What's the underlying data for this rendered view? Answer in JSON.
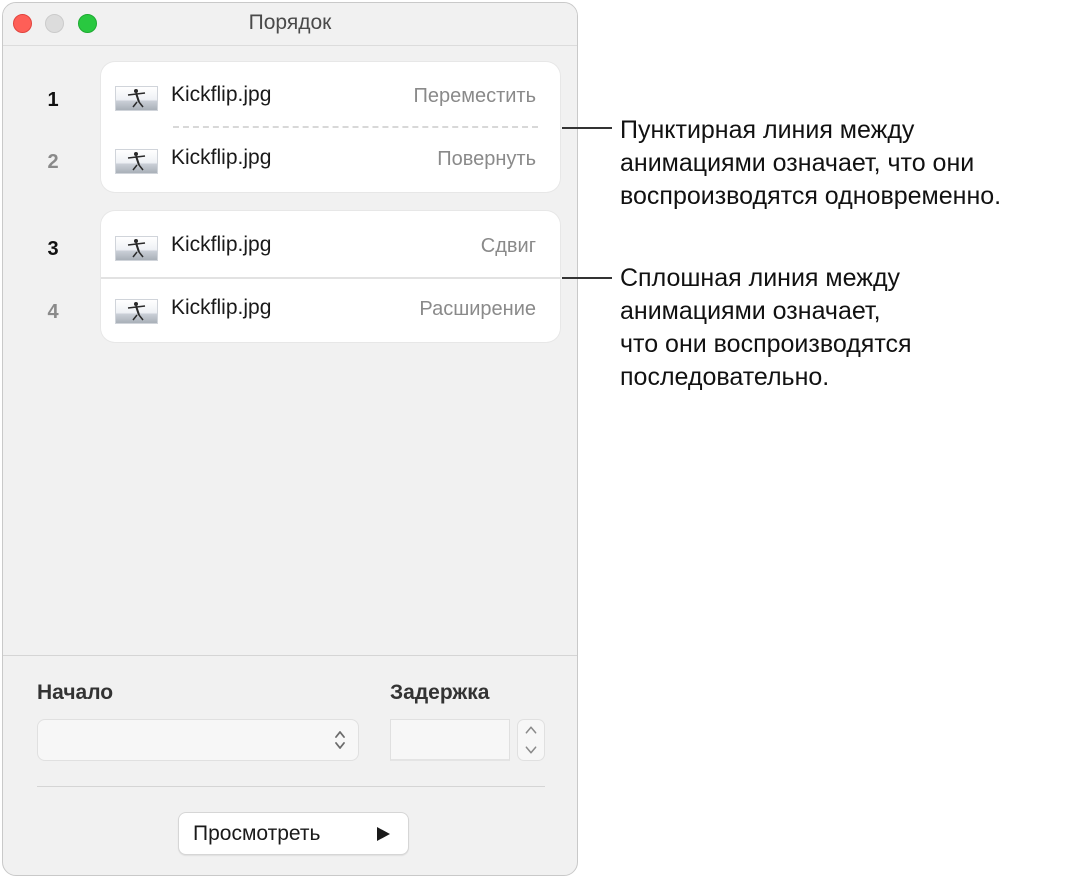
{
  "window": {
    "title": "Порядок"
  },
  "animations": [
    {
      "number": "1",
      "file": "Kickflip.jpg",
      "effect": "Переместить"
    },
    {
      "number": "2",
      "file": "Kickflip.jpg",
      "effect": "Повернуть"
    },
    {
      "number": "3",
      "file": "Kickflip.jpg",
      "effect": "Сдвиг"
    },
    {
      "number": "4",
      "file": "Kickflip.jpg",
      "effect": "Расширение"
    }
  ],
  "controls": {
    "start_label": "Начало",
    "start_value": "",
    "delay_label": "Задержка",
    "delay_value": "",
    "preview_label": "Просмотреть"
  },
  "callouts": {
    "dashed": "Пунктирная линия между\nанимациями означает, что они\nвоспроизводятся одновременно.",
    "solid": "Сплошная линия между\nанимациями означает,\nчто они воспроизводятся\nпоследовательно."
  },
  "icons": {
    "close": "close-button-icon",
    "minimize": "minimize-button-icon",
    "maximize": "zoom-button-icon",
    "thumbnail": "skateboarder-photo-icon",
    "popup": "up-down-chevron-icon",
    "stepper_up": "chevron-up-icon",
    "stepper_down": "chevron-down-icon",
    "play": "play-icon"
  },
  "colors": {
    "close": "#fe5f57",
    "minimize": "#dcdcdc",
    "maximize": "#29c840",
    "window_bg": "#f1f1f1",
    "card_bg": "#ffffff",
    "secondary_text": "#8a8a8a"
  }
}
